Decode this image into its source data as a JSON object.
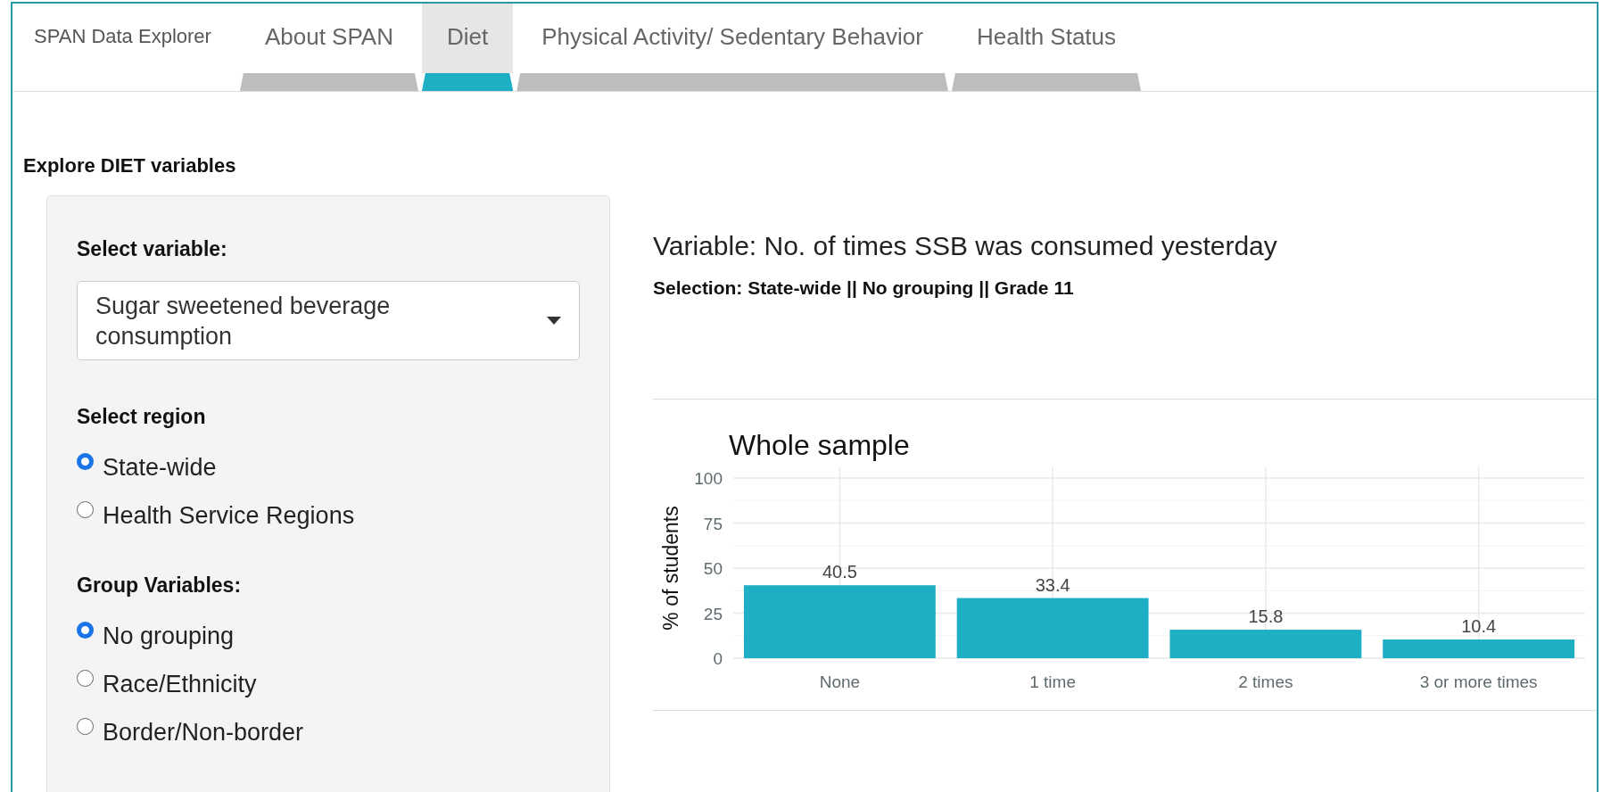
{
  "navbar": {
    "brand": "SPAN Data Explorer",
    "tabs": [
      {
        "label": "About SPAN",
        "selected": false
      },
      {
        "label": "Diet",
        "selected": true
      },
      {
        "label": "Physical Activity/ Sedentary Behavior",
        "selected": false
      },
      {
        "label": "Health Status",
        "selected": false
      }
    ]
  },
  "page_title": "Explore DIET variables",
  "sidebar": {
    "variable": {
      "label": "Select variable:",
      "value": "Sugar sweetened beverage consumption"
    },
    "region": {
      "label": "Select region",
      "options": [
        {
          "label": "State-wide",
          "selected": true
        },
        {
          "label": "Health Service Regions",
          "selected": false
        }
      ]
    },
    "group": {
      "label": "Group Variables:",
      "options": [
        {
          "label": "No grouping",
          "selected": true
        },
        {
          "label": "Race/Ethnicity",
          "selected": false
        },
        {
          "label": "Border/Non-border",
          "selected": false
        }
      ]
    }
  },
  "main": {
    "heading": "Variable: No. of times SSB was consumed yesterday",
    "selection": "Selection: State-wide || No grouping || Grade 11",
    "chart_data": {
      "type": "bar",
      "title": "Whole sample",
      "ylabel": "% of students",
      "categories": [
        "None",
        "1 time",
        "2 times",
        "3 or more times"
      ],
      "series": [
        {
          "color": "#1eafc4",
          "values": [
            40.5,
            33.4,
            15.8,
            10.4
          ]
        }
      ],
      "grid": true,
      "ylim": [
        0,
        100
      ],
      "yticks": [
        0,
        25,
        50,
        75,
        100
      ],
      "data_labels": true
    }
  }
}
